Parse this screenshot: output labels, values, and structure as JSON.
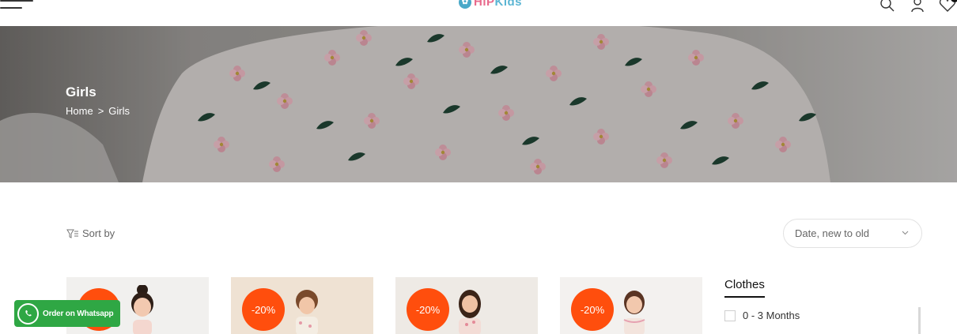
{
  "header": {
    "logo_prefix": "HiP",
    "logo_suffix": "Kids",
    "icons": [
      "menu-icon",
      "search-icon",
      "user-icon",
      "heart-icon"
    ]
  },
  "banner": {
    "title": "Girls",
    "breadcrumb": {
      "home": "Home",
      "separator": ">",
      "current": "Girls"
    }
  },
  "toolbar": {
    "sort_label": "Sort by",
    "sort_selected": "Date, new to old"
  },
  "products": [
    {
      "discount": "-20%"
    },
    {
      "discount": "-20%"
    },
    {
      "discount": "-20%"
    },
    {
      "discount": "-20%"
    }
  ],
  "filter": {
    "title": "Clothes",
    "options": [
      "0 - 3 Months"
    ]
  },
  "whatsapp": {
    "label": "Order on Whatsapp"
  },
  "colors": {
    "accent": "#ff4e0d",
    "whatsapp": "#2fa744",
    "logo_pink": "#e86a8c",
    "logo_blue": "#5bb5d3"
  }
}
